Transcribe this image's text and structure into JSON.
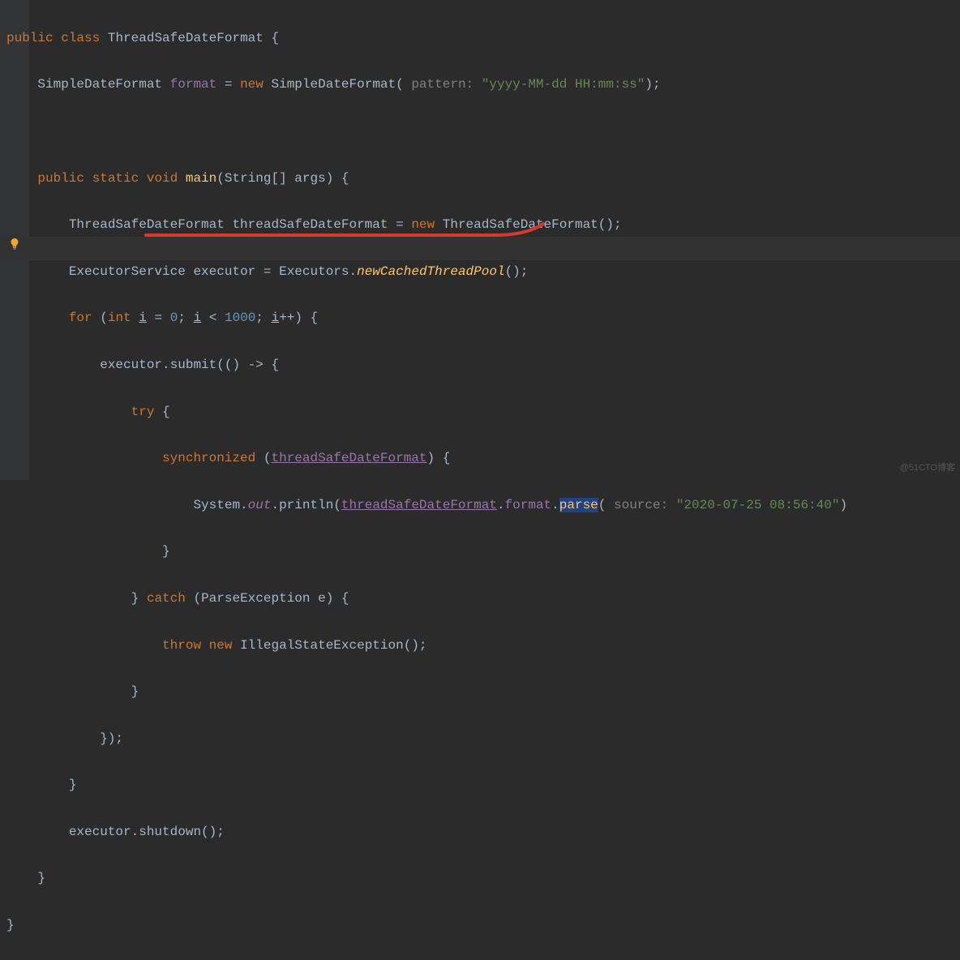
{
  "code": {
    "l1": {
      "public": "public",
      "class": "class",
      "name": "ThreadSafeDateFormat",
      "brace": "{"
    },
    "l2": {
      "type": "SimpleDateFormat",
      "field": "format",
      "eq": "=",
      "new": "new",
      "ctor": "SimpleDateFormat",
      "paramHint": "pattern:",
      "str": "\"yyyy-MM-dd HH:mm:ss\"",
      "end": ");"
    },
    "l3": {
      "public": "public",
      "static": "static",
      "void": "void",
      "main": "main",
      "args": "(String[] args) {"
    },
    "l4": {
      "type": "ThreadSafeDateFormat",
      "var": "threadSafeDateFormat",
      "eq": "=",
      "new": "new",
      "ctor": "ThreadSafeDateFormat",
      "end": "();"
    },
    "l5": {
      "type": "ExecutorService",
      "var": "executor",
      "eq": "=",
      "cls": "Executors",
      "dot": ".",
      "m": "newCachedThreadPool",
      "end": "();"
    },
    "l6": {
      "for": "for",
      "open": "(",
      "int": "int",
      "i1": "i",
      "eq": "=",
      "zero": "0",
      "sc1": ";",
      "i2": "i",
      "lt": "<",
      "thou": "1000",
      "sc2": ";",
      "i3": "i",
      "pp": "++",
      "close": ") {"
    },
    "l7": {
      "txt": "executor.submit(() -> {"
    },
    "l8": {
      "try": "try",
      "brace": "{"
    },
    "l9": {
      "sync": "synchronized",
      "open": "(",
      "ref": "threadSafeDateFormat",
      "close": ") {"
    },
    "l10": {
      "sys": "System",
      "dot1": ".",
      "out": "out",
      "dot2": ".",
      "println": "println",
      "open": "(",
      "ref": "threadSafeDateFormat",
      "dot3": ".",
      "fmt": "format",
      "dot4": ".",
      "parse": "parse",
      "open2": "(",
      "paramHint": "source:",
      "str": "\"2020-07-25 08:56:40\"",
      "end": ")"
    },
    "l11": {
      "brace": "}"
    },
    "l12": {
      "brace": "}",
      "catch": "catch",
      "exc": "(ParseException e) {"
    },
    "l13": {
      "throw": "throw",
      "new": "new",
      "ctor": "IllegalStateException",
      "end": "();"
    },
    "l14": {
      "brace": "}"
    },
    "l15": {
      "end": "});"
    },
    "l16": {
      "brace": "}"
    },
    "l17": {
      "txt": "executor.shutdown();"
    },
    "l18": {
      "brace": "}"
    },
    "l19": {
      "brace": "}"
    }
  },
  "watermark": "@51CTO博客"
}
